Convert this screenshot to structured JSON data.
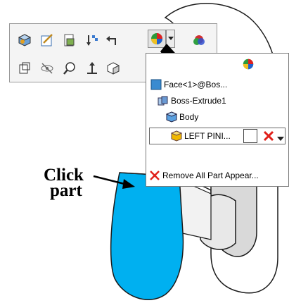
{
  "annotation": {
    "line1": "Click",
    "line2": "part"
  },
  "toolbar": {
    "row1": [
      {
        "icon": "component-icon"
      },
      {
        "icon": "edit-sketch-icon"
      },
      {
        "icon": "document-properties-icon"
      },
      {
        "icon": "sort-order-icon"
      },
      {
        "icon": "undo-arrow-icon"
      },
      {
        "icon": "appearance-icon"
      },
      {
        "icon": "appearance-dropdown-icon"
      },
      {
        "icon": "scene-appearance-icon"
      }
    ],
    "row2": [
      {
        "icon": "section-view-icon"
      },
      {
        "icon": "hide-show-icon"
      },
      {
        "icon": "zoom-selection-icon"
      },
      {
        "icon": "normal-to-icon"
      },
      {
        "icon": "view-cube-icon"
      }
    ]
  },
  "appearance_menu": {
    "items": [
      {
        "label": "Face<1>@Bos...",
        "icon": "face-icon"
      },
      {
        "label": "Boss-Extrude1",
        "icon": "feature-icon"
      },
      {
        "label": "Body",
        "icon": "body-icon"
      },
      {
        "label": "LEFT PINI...",
        "icon": "part-icon"
      },
      {
        "label": "Remove All Part Appear...",
        "icon": "remove-x-icon"
      }
    ]
  },
  "colors": {
    "highlight_face": "#00b0f0",
    "remove_red": "#e0201a",
    "face_blue": "#3a8bd0",
    "part_yellow": "#f1b800"
  }
}
